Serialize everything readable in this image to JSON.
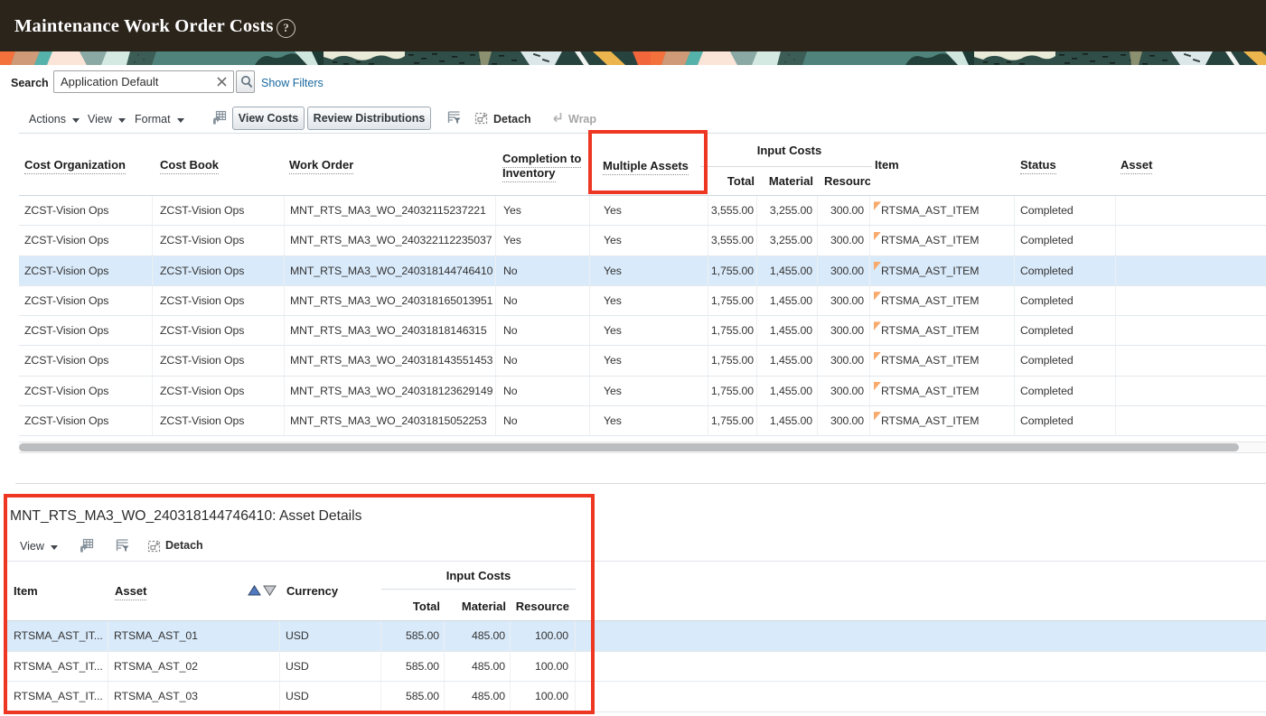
{
  "app": {
    "title": "Maintenance Work Order Costs",
    "help_glyph": "?"
  },
  "search": {
    "label": "Search",
    "value": "Application Default",
    "show_filters_label": "Show Filters"
  },
  "toolbar": {
    "menus": {
      "actions": "Actions",
      "view": "View",
      "format": "Format"
    },
    "view_costs_label": "View Costs",
    "review_distributions_label": "Review Distributions",
    "detach_label": "Detach",
    "wrap_label": "Wrap"
  },
  "results_table": {
    "group_header": "Input Costs",
    "columns": {
      "cost_organization": "Cost Organization",
      "cost_book": "Cost Book",
      "work_order": "Work Order",
      "completion_to_inventory": "Completion to Inventory",
      "multiple_assets": "Multiple Assets",
      "total": "Total",
      "material": "Material",
      "resource": "Resource",
      "item": "Item",
      "status": "Status",
      "asset": "Asset"
    },
    "selected_row": 2,
    "rows": [
      [
        "ZCST-Vision Ops",
        "ZCST-Vision Ops",
        "MNT_RTS_MA3_WO_24032115237221",
        "Yes",
        "Yes",
        "3,555.00",
        "3,255.00",
        "300.00",
        "RTSMA_AST_ITEM",
        "Completed",
        ""
      ],
      [
        "ZCST-Vision Ops",
        "ZCST-Vision Ops",
        "MNT_RTS_MA3_WO_240322112235037",
        "Yes",
        "Yes",
        "3,555.00",
        "3,255.00",
        "300.00",
        "RTSMA_AST_ITEM",
        "Completed",
        ""
      ],
      [
        "ZCST-Vision Ops",
        "ZCST-Vision Ops",
        "MNT_RTS_MA3_WO_240318144746410",
        "No",
        "Yes",
        "1,755.00",
        "1,455.00",
        "300.00",
        "RTSMA_AST_ITEM",
        "Completed",
        ""
      ],
      [
        "ZCST-Vision Ops",
        "ZCST-Vision Ops",
        "MNT_RTS_MA3_WO_240318165013951",
        "No",
        "Yes",
        "1,755.00",
        "1,455.00",
        "300.00",
        "RTSMA_AST_ITEM",
        "Completed",
        ""
      ],
      [
        "ZCST-Vision Ops",
        "ZCST-Vision Ops",
        "MNT_RTS_MA3_WO_24031818146315",
        "No",
        "Yes",
        "1,755.00",
        "1,455.00",
        "300.00",
        "RTSMA_AST_ITEM",
        "Completed",
        ""
      ],
      [
        "ZCST-Vision Ops",
        "ZCST-Vision Ops",
        "MNT_RTS_MA3_WO_240318143551453",
        "No",
        "Yes",
        "1,755.00",
        "1,455.00",
        "300.00",
        "RTSMA_AST_ITEM",
        "Completed",
        ""
      ],
      [
        "ZCST-Vision Ops",
        "ZCST-Vision Ops",
        "MNT_RTS_MA3_WO_240318123629149",
        "No",
        "Yes",
        "1,755.00",
        "1,455.00",
        "300.00",
        "RTSMA_AST_ITEM",
        "Completed",
        ""
      ],
      [
        "ZCST-Vision Ops",
        "ZCST-Vision Ops",
        "MNT_RTS_MA3_WO_24031815052253",
        "No",
        "Yes",
        "1,755.00",
        "1,455.00",
        "300.00",
        "RTSMA_AST_ITEM",
        "Completed",
        ""
      ]
    ]
  },
  "detail_panel": {
    "title": "MNT_RTS_MA3_WO_240318144746410: Asset Details",
    "toolbar": {
      "view": "View",
      "detach_label": "Detach"
    },
    "group_header": "Input Costs",
    "columns": {
      "item": "Item",
      "asset": "Asset",
      "currency": "Currency",
      "total": "Total",
      "material": "Material",
      "resource": "Resource"
    },
    "selected_row": 0,
    "rows": [
      [
        "RTSMA_AST_IT...",
        "RTSMA_AST_01",
        "USD",
        "585.00",
        "485.00",
        "100.00"
      ],
      [
        "RTSMA_AST_IT...",
        "RTSMA_AST_02",
        "USD",
        "585.00",
        "485.00",
        "100.00"
      ],
      [
        "RTSMA_AST_IT...",
        "RTSMA_AST_03",
        "USD",
        "585.00",
        "485.00",
        "100.00"
      ]
    ]
  },
  "colors": {
    "annotation_red": "#ee3722",
    "header_bg": "#2b241b",
    "selected_row": "#d9eafa",
    "link_blue": "#19689f"
  }
}
